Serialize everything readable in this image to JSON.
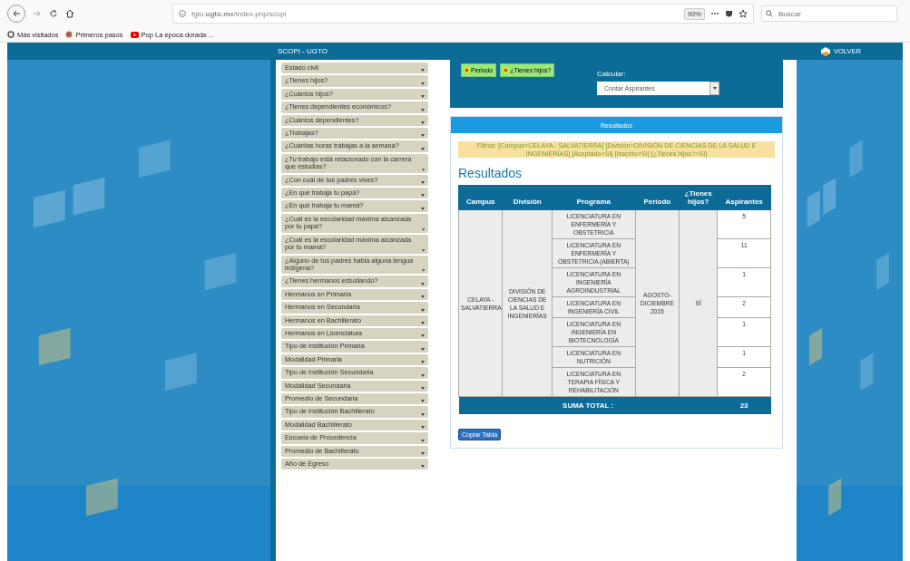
{
  "browser": {
    "address": "fgto.**ugto.mx**/index.php/scopi",
    "zoom": "90%",
    "search_placeholder": "Buscar",
    "bookmarks": [
      "Más visitados",
      "Primeros pasos",
      "Pop La epoca dorada ..."
    ]
  },
  "header": {
    "title": "SCOPI - UGTO",
    "back_link": "VOLVER"
  },
  "sidebar": {
    "items": [
      "Estado civil",
      "¿Tienes hijos?",
      "¿Cuántos hijos?",
      "¿Tienes dependientes económicos?",
      "¿Cuántos dependientes?",
      "¿Trabajas?",
      "¿Cuántas horas trabajas a la semana?",
      "¿Tu trabajo está relacionado con la carrera que estudias?",
      "¿Con cuál de tus padres vives?",
      "¿En qué trabaja tu papá?",
      "¿En qué trabaja tu mamá?",
      "¿Cuál es la escolaridad máxima alcanzada por tu papá?",
      "¿Cuál es la escolaridad máxima alcanzada por tu mamá?",
      "¿Alguno de tus padres habla alguna lengua indígena?",
      "¿Tienes hermanos estudiando?",
      "Hermanos en Primaria",
      "Hermanos en Secundaria",
      "Hermanos en Bachillerato",
      "Hermanos en Licenciatura",
      "Tipo de institución Primaria",
      "Modalidad Primaria",
      "Tipo de institución Secundaria",
      "Modalidad Secundaria",
      "Promedio de Secundaria",
      "Tipo de institución Bachillerato",
      "Modalidad Bachillerato",
      "Escuela de Procedencia",
      "Promedio de Bachillerato",
      "Año de Egreso"
    ]
  },
  "controls": {
    "chips": [
      "Periodo",
      "¿Tienes hijos?"
    ],
    "calc_label": "Calcular:",
    "calc_value": "Contar Aspirantes"
  },
  "results": {
    "panel_title": "Resultados",
    "filters": "Filtros: [Campus=CELAYA - SALVATIERRA] [División=DIVISIÓN DE CIENCIAS DE LA SALUD E INGENIERÍAS] [Aceptado=SI] [Inscrito=SI] [¿Tienes hijos?=SI]",
    "heading": "Resultados",
    "table": {
      "columns": [
        "Campus",
        "División",
        "Programa",
        "Periodo",
        "¿Tienes hijos?",
        "Aspirantes"
      ],
      "group": {
        "campus": "CELAYA - SALVATIERRA",
        "division": "DIVISIÓN DE CIENCIAS DE LA SALUD E INGENIERÍAS",
        "periodo": "AGOSTO-DICIEMBRE 2015",
        "tienes_hijos": "SÍ"
      },
      "rows": [
        {
          "programa": "LICENCIATURA EN ENFERMERÍA Y OBSTETRICIA",
          "aspirantes": "5"
        },
        {
          "programa": "LICENCIATURA EN ENFERMERÍA Y OBSTETRICIA (ABIERTA)",
          "aspirantes": "11"
        },
        {
          "programa": "LICENCIATURA EN INGENIERÍA AGROINDUSTRIAL",
          "aspirantes": "1"
        },
        {
          "programa": "LICENCIATURA EN INGENIERÍA CIVIL",
          "aspirantes": "2"
        },
        {
          "programa": "LICENCIATURA EN INGENIERÍA EN BIOTECNOLOGÍA",
          "aspirantes": "1"
        },
        {
          "programa": "LICENCIATURA EN NUTRICIÓN",
          "aspirantes": "1"
        },
        {
          "programa": "LICENCIATURA EN TERAPIA FÍSICA Y REHABILITACIÓN",
          "aspirantes": "2"
        }
      ],
      "total": {
        "label": "SUMA TOTAL :",
        "value": "23"
      }
    },
    "copy_button": "Copiar Tabla"
  }
}
